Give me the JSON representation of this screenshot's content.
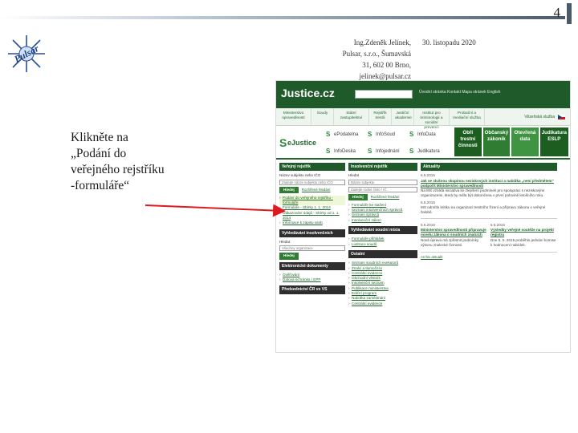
{
  "slide": {
    "number": "4",
    "author_lines": [
      "Ing.Zdeněk Jelínek,",
      "Pulsar, s.r.o., Šumavská",
      "31, 602 00 Brno,",
      "jelinek@pulsar.cz"
    ],
    "date": "30. listopadu 2020",
    "instruction_lines": [
      "Klikněte na",
      "„Podání do",
      "veřejného rejstříku",
      "-formuláře“"
    ],
    "logo_text": "Pulsar",
    "accent_color": "#4b5a6b",
    "arrow_color": "#e0191f"
  },
  "site": {
    "logo": "Justice.cz",
    "header_links": "Úvodní stránka   Kontakt   Mapa stránek   English",
    "nav": [
      "Ministerstvo spravedlnosti",
      "Soudy",
      "Státní zastupitelství",
      "Rejstřík trestů",
      "Justiční akademie",
      "Institut pro kriminologii a sociální prevenci",
      "Probační a mediační služba"
    ],
    "nav_tools": "Vězeňská služba",
    "apps": {
      "big": "eJustice",
      "small": [
        "ePodatelna",
        "InfoSoud",
        "InfoData",
        "InfoDeska",
        "Infojednání",
        "Judikatura"
      ]
    },
    "tiles": [
      [
        "Obří",
        "trestní",
        "činnosti"
      ],
      [
        "Občanský",
        "zákoník"
      ],
      [
        "Otevřená",
        "data"
      ],
      [
        "Judikatura",
        "ESLP"
      ]
    ],
    "col1": {
      "public_register_title": "Veřejný rejstřík",
      "field_label_1": "Název subjektu nebo IČO",
      "field_value_1": "Zadejte název subjektu nebo IČO",
      "search_btn": "Hledej",
      "advanced_link": "Rozšířené hledání",
      "links": [
        "Podání do veřejného rejstříku - formuláře",
        "Formuláře - Sbírky 1. 1. 2014",
        "Odkazování údajů - Sbírky od 1. 1. 2014",
        "Informace k zápisu osob"
      ],
      "auction_title": "Vyhledávání insolvenčních",
      "auction_field_label": "Hledat",
      "auction_field_value": "Všechny organizace",
      "auction_btn": "Hledej",
      "edocs_title": "Elektronické dokumenty",
      "edocs_links": [
        "Ověřování",
        "Datová schránka / EPP"
      ],
      "ms_title": "Předsednictví ČR ve VS"
    },
    "col2": {
      "insolvency_title": "Insolvenční rejstřík",
      "field_label": "Hledat",
      "field_value_1": "Název subjektu",
      "field_value_2": "Zadejte rodné číslo / IČ",
      "search_btn": "Hledej",
      "advanced_link": "Rozšířené hledání",
      "links": [
        "Formuláře ke stažení",
        "Seznam insolvenčních správců",
        "Seznam správců",
        "Insolvenční zákon"
      ],
      "auction_title": "Vyhledávání soudní místa",
      "auction_links": [
        "Formuláře přihlášek",
        "Lustrace soudů"
      ],
      "other_title": "Ostatní",
      "other_links": [
        "Seznam soudních exekutorů",
        "Znalci a tlumočníci",
        "Centrální evidence",
        "Obchodní věstník",
        "Insolvenční seznam",
        "Publikace ministerstva",
        "Ediční program",
        "Nabídka zaměstnání",
        "Centrální evidence"
      ]
    },
    "col3": {
      "news_title": "Aktuality",
      "items": [
        {
          "date": "6.5.2015",
          "title": "Jak se slušnou skupinou neziskových institucí a nabídka „není předmětem“ podpořit Ministerstvo spravedlnosti",
          "text": "Na MS vznikla iniciativa ke zlepšení podmínek pro spolupráci s neziskovými organizacemi, která by měla být dokončena v první polovině letošního roku."
        },
        {
          "date": "6.5.2015",
          "title": "",
          "text": "MS odmítlo kritiku na organizaci trestního řízení a přípravu zákona o veřejné žalobě."
        }
      ],
      "split_left": {
        "date": "6.5.2015",
        "title": "Ministerstvo spravedlnosti připravuje novelu zákona o soudních znalcích",
        "text": "Nová úprava má zpřesnit podmínky výkonu znalecké činnosti."
      },
      "split_right": {
        "date": "5.5.2015",
        "title": "Výsledky veřejné soutěže na projekt registru",
        "text": "Dne 5. 5. 2015 proběhlo jednání komise k hodnocení nabídek."
      },
      "more_link": "Archiv aktualit"
    }
  }
}
